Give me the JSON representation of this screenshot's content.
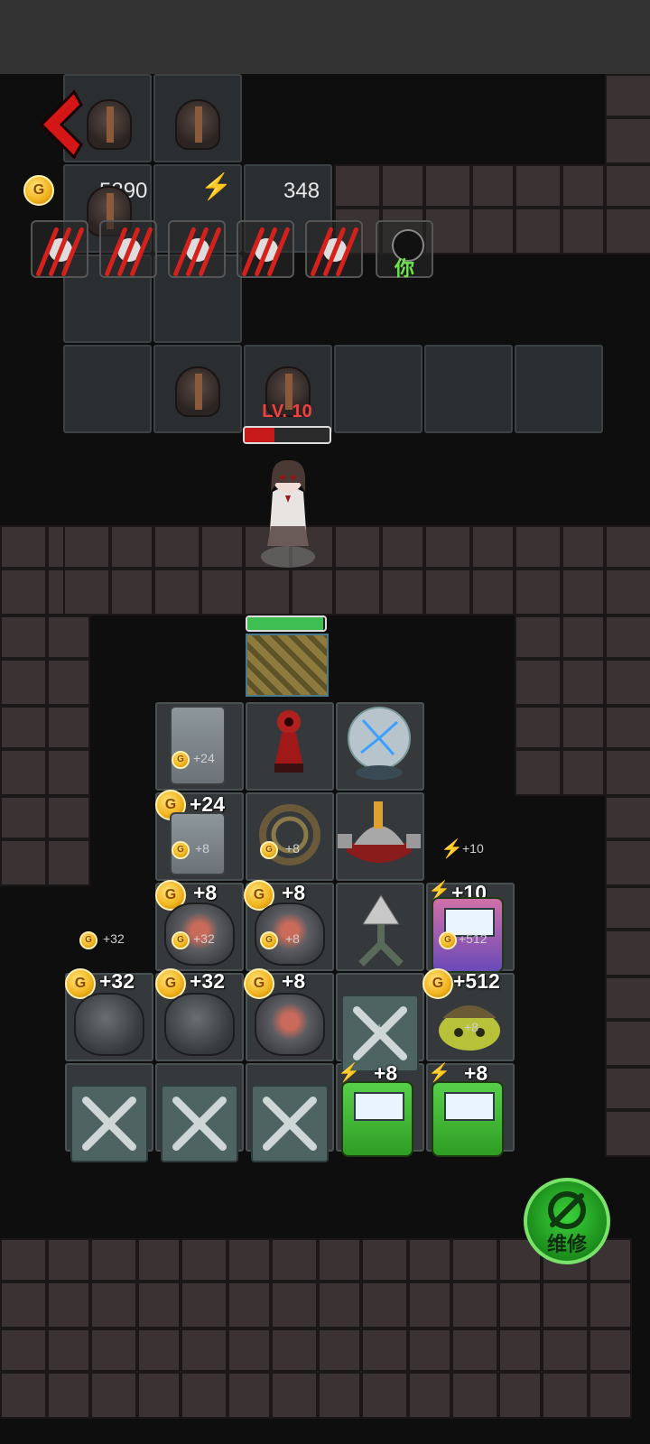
{
  "resources": {
    "gold": "5390",
    "energy": "348",
    "coin_symbol": "G"
  },
  "enemy": {
    "level": "LV. 10",
    "hp_fraction": 0.35
  },
  "door": {
    "hp_fraction": 0.98
  },
  "players": {
    "you_label": "你"
  },
  "yields": {
    "fridge_top": "+24",
    "fridge_bottom_big": "+24",
    "fridge_bottom_small": "+8",
    "thorns_small": "+8",
    "bolt_side": "+10",
    "rock_r3c1_big": "+8",
    "rock_r3c1_small": "+32",
    "rock_r3c2_big": "+8",
    "rock_r3c2_small": "+8",
    "arcade_pink_big": "+10",
    "arcade_pink_small": "+512",
    "side_coin": "+32",
    "rock_r4c0_big": "+32",
    "rock_r4c1_big": "+32",
    "rock_r4c2_big": "+8",
    "wrench_r4c3_small": "+8",
    "bug_r4c4_big": "+512",
    "bug_r4c4_small": "+8",
    "arcade_r5c3_big": "+8",
    "arcade_r5c4_big": "+8"
  },
  "repair": {
    "label": "维修"
  },
  "icons": {
    "back": "chevron-left-icon",
    "gold": "gold-coin-icon",
    "energy": "lightning-icon",
    "repair": "gear-wrench-icon"
  },
  "colors": {
    "hp_red": "#c81a1a",
    "door_green": "#3fbe52",
    "repair_green": "#2fbf2f"
  }
}
